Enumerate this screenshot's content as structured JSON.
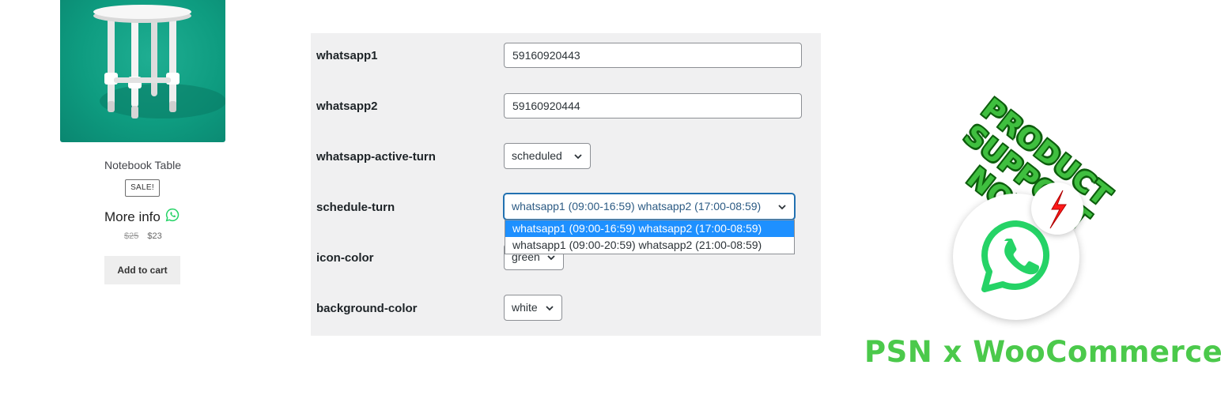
{
  "product": {
    "title": "Notebook Table",
    "sale_badge": "SALE!",
    "more_info": "More info",
    "price_old": "$25",
    "price_new": "$23",
    "add_to_cart": "Add to cart"
  },
  "settings": {
    "whatsapp1": {
      "label": "whatsapp1",
      "value": "59160920443"
    },
    "whatsapp2": {
      "label": "whatsapp2",
      "value": "59160920444"
    },
    "active_turn": {
      "label": "whatsapp-active-turn",
      "value": "scheduled"
    },
    "schedule_turn": {
      "label": "schedule-turn",
      "value": "whatsapp1 (09:00-16:59) whatsapp2 (17:00-08:59)",
      "options": [
        "whatsapp1 (09:00-16:59) whatsapp2 (17:00-08:59)",
        "whatsapp1 (09:00-20:59) whatsapp2 (21:00-08:59)"
      ]
    },
    "icon_color": {
      "label": "icon-color",
      "value": "green"
    },
    "background_color": {
      "label": "background-color",
      "value": "white"
    }
  },
  "promo": {
    "headline": [
      "PRODUCT",
      "SUPPORT",
      "NOW!"
    ],
    "brand": "PSN x WooCommerce"
  },
  "colors": {
    "whatsapp_green": "#25d366",
    "promo_green": "#3fbf3f",
    "panel_bg": "#f0f0f1",
    "selected_option": "#1e90ff",
    "product_bg": "#0e9c80"
  },
  "icons": {
    "whatsapp": "whatsapp-icon",
    "chevron": "chevron-down-icon",
    "notification": "lightning-icon"
  }
}
